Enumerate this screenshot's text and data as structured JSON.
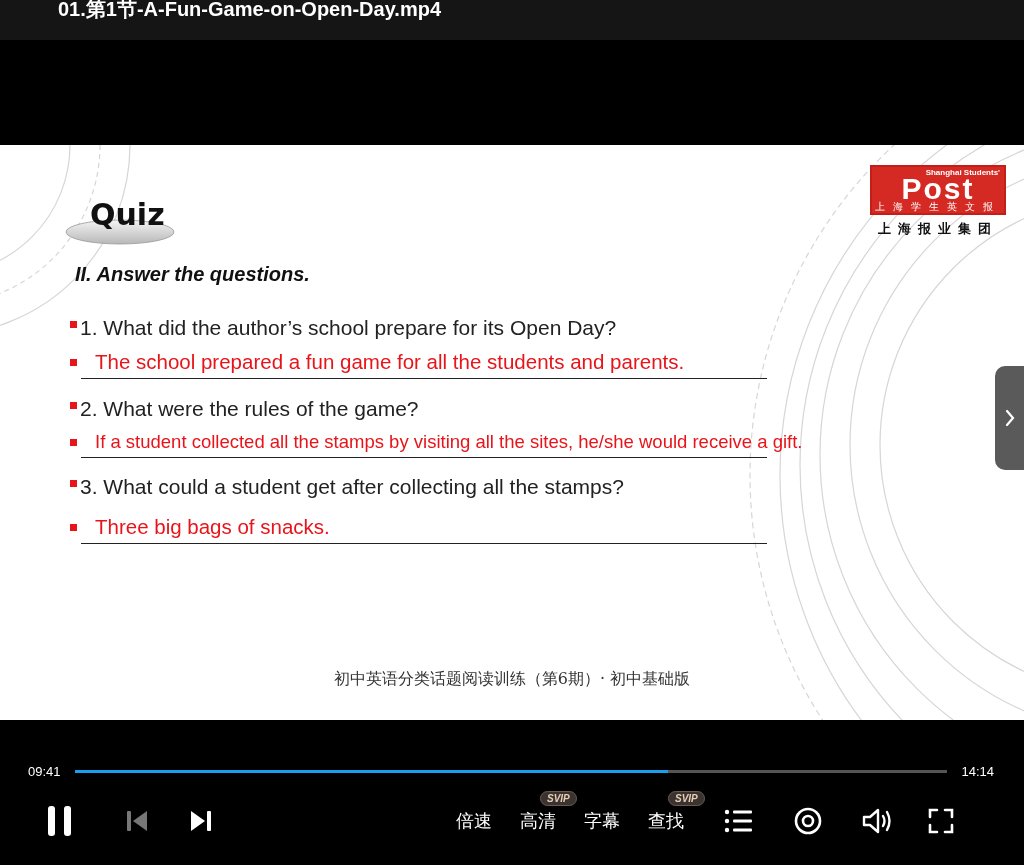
{
  "window": {
    "title": "01.第1节-A-Fun-Game-on-Open-Day.mp4"
  },
  "slide": {
    "quiz_title": "Quiz",
    "logo": {
      "brand": "Post",
      "tagline": "Shanghai Students'",
      "sub": "上海学生英文报",
      "group": "上海报业集团"
    },
    "heading": "II. Answer the questions.",
    "questions": [
      {
        "question": "1. What did the author’s school prepare for its Open Day?",
        "answer": "The school prepared a fun game for all the students and parents."
      },
      {
        "question": "2. What were the rules of the game?",
        "answer": "If a student collected all the stamps by visiting all the sites, he/she would receive a gift."
      },
      {
        "question": "3. What could a student get after collecting all the stamps?",
        "answer": "Three big bags of snacks."
      }
    ],
    "footer": "初中英语分类话题阅读训练（第6期）· 初中基础版"
  },
  "player": {
    "elapsed": "09:41",
    "duration": "14:14",
    "progress": {
      "level": 0.68
    },
    "playing": true,
    "previous": {
      "disabled": true
    },
    "next": {
      "disabled": false
    },
    "options": [
      {
        "label": "倍速"
      },
      {
        "label": "高清",
        "badge": "SVIP"
      },
      {
        "label": "字幕"
      },
      {
        "label": "查找",
        "badge": "SVIP"
      }
    ]
  }
}
